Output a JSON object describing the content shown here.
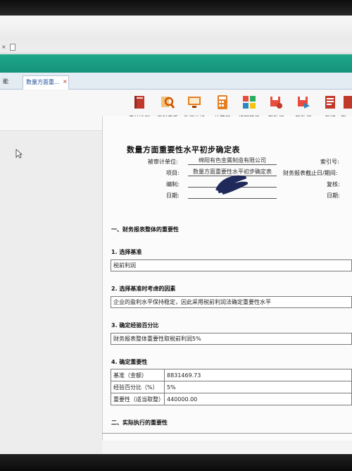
{
  "browser": {
    "tab_x": "×",
    "dots": "..."
  },
  "tabs": {
    "first_label": "能",
    "active_label": "数量方面重...",
    "close": "×"
  },
  "toolbar": {
    "items": [
      {
        "label": "审计准则",
        "icon": "book-icon",
        "color": "#c0392b"
      },
      {
        "label": "资料查看",
        "icon": "magnifier-icon",
        "color": "#e67e22"
      },
      {
        "label": "数据分析",
        "icon": "monitor-icon",
        "color": "#d35400"
      },
      {
        "label": "计算器",
        "icon": "calculator-icon",
        "color": "#e67e22"
      },
      {
        "label": "填写符号",
        "icon": "windows-icon",
        "color": "#27ae60"
      },
      {
        "label": "存数据",
        "icon": "save-icon",
        "color": "#e74c3c"
      },
      {
        "label": "取数据",
        "icon": "load-icon",
        "color": "#2e86c1"
      },
      {
        "label": "复核",
        "icon": "review-icon",
        "color": "#c0392b"
      },
      {
        "label": "存",
        "icon": "store-icon",
        "color": "#c0392b"
      }
    ]
  },
  "doc": {
    "title": "数量方面重要性水平初步确定表",
    "header": {
      "audited_unit_label": "被审计单位:",
      "audited_unit_value": "绵阳有色金属制造有限公司",
      "item_label": "项目:",
      "item_value": "数量方面重要性水平初步确定表",
      "prepared_label": "编制:",
      "date_label": "日期:",
      "index_label": "索引号:",
      "report_end_label": "财务报表截止日/期间:",
      "review_label": "复核:",
      "date2_label": "日期:"
    },
    "section1_title": "一、财务报表整体的重要性",
    "q1_title": "1. 选择基准",
    "q1_value": "税前利润",
    "q2_title": "2. 选择基准时考虑的因素",
    "q2_value": "企业的盈利水平保持稳定，因此采用税前利润法确定重要性水平",
    "q3_title": "3. 确定经验百分比",
    "q3_value": "财务报表整体重要性取税前利润5%",
    "q4_title": "4. 确定重要性",
    "table": [
      {
        "k": "基准（金额）",
        "v": "8831469.73"
      },
      {
        "k": "经验百分比（%）",
        "v": "5%"
      },
      {
        "k": "重要性（适当取整）",
        "v": "440000.00"
      }
    ],
    "section2_title": "二、实际执行的重要性"
  }
}
